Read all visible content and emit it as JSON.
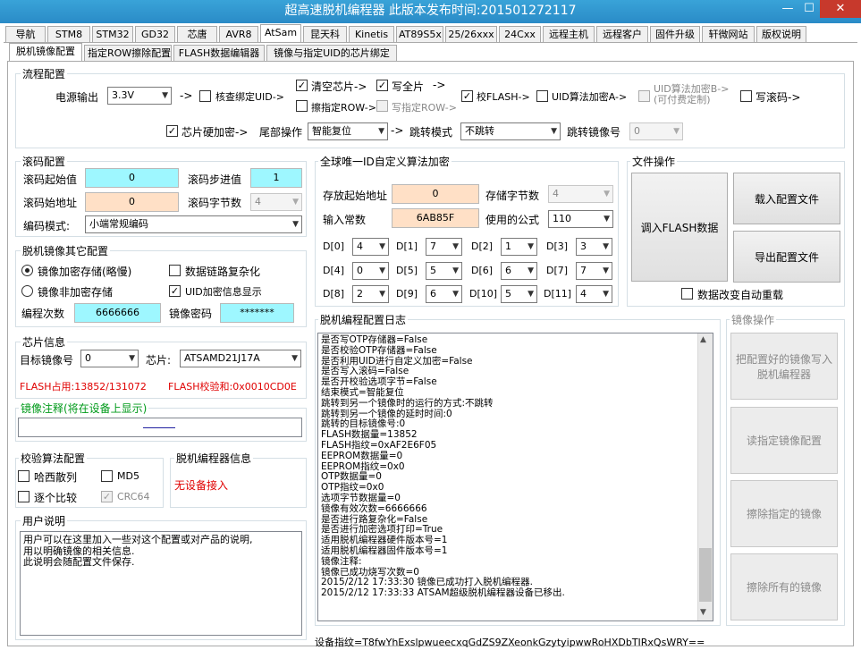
{
  "window": {
    "title": "超高速脱机编程器      此版本发布时间:201501272117",
    "min_label": "—",
    "max_label": "☐",
    "close_label": "✕"
  },
  "main_tabs": [
    "导航",
    "STM8",
    "STM32",
    "GD32",
    "芯唐",
    "AVR8",
    "AtSam",
    "昆天科",
    "Kinetis",
    "AT89S5x",
    "25/26xxx",
    "24Cxx",
    "远程主机",
    "远程客户",
    "固件升级",
    "轩微网站",
    "版权说明"
  ],
  "sub_tabs": [
    "脱机镜像配置",
    "指定ROW擦除配置",
    "FLASH数据编辑器",
    "镜像与指定UID的芯片绑定"
  ],
  "flow": {
    "title": "流程配置",
    "power_label": "电源输出",
    "power_value": "3.3V",
    "arrow": "->",
    "verify_uid": "核查绑定UID->",
    "clear_chip": "清空芯片->",
    "write_all": "写全片",
    "write_arrow": "->",
    "verify_flash": "校FLASH->",
    "uid_a": "UID算法加密A->",
    "uid_b": "UID算法加密B->\n(可付费定制)",
    "write_code": "写滚码->",
    "erase_row": "擦指定ROW->",
    "write_row": "写指定ROW->",
    "chip_hw": "芯片硬加密->",
    "tail_label": "尾部操作",
    "tail_value": "智能复位",
    "jump_mode_label": "跳转模式",
    "jump_mode_value": "不跳转",
    "jump_image_label": "跳转镜像号",
    "jump_image_value": "0"
  },
  "rolling": {
    "title": "滚码配置",
    "start_label": "滚码起始值",
    "start_value": "0",
    "step_label": "滚码步进值",
    "step_value": "1",
    "addr_label": "滚码始地址",
    "addr_value": "0",
    "bytes_label": "滚码字节数",
    "bytes_value": "4",
    "mode_label": "编码模式:",
    "mode_value": "小端常规编码"
  },
  "other": {
    "title": "脱机镜像其它配置",
    "enc_store": "镜像加密存储(略慢)",
    "nonenc_store": "镜像非加密存储",
    "link_complex": "数据链路复杂化",
    "uid_show": "UID加密信息显示",
    "count_label": "编程次数",
    "count_value": "6666666",
    "pwd_label": "镜像密码",
    "pwd_value": "*******"
  },
  "chip": {
    "title": "芯片信息",
    "target_label": "目标镜像号",
    "target_value": "0",
    "chip_label": "芯片:",
    "chip_value": "ATSAMD21J17A",
    "flash_used": "FLASH占用:13852/131072",
    "flash_checksum": "FLASH校验和:0x0010CD0E"
  },
  "note": {
    "title": "镜像注释(将在设备上显示)"
  },
  "checksum": {
    "title": "校验算法配置",
    "hash": "哈西散列",
    "md5": "MD5",
    "compare": "逐个比较",
    "crc64": "CRC64"
  },
  "programmer_info": {
    "title": "脱机编程器信息",
    "status": "无设备接入"
  },
  "user_note": {
    "title": "用户说明",
    "text": "用户可以在这里加入一些对这个配置或对产品的说明,\n用以明确镜像的相关信息.\n此说明会随配置文件保存."
  },
  "uid": {
    "title": "全球唯一ID自定义算法加密",
    "addr_label": "存放起始地址",
    "addr_value": "0",
    "bytes_label": "存储字节数",
    "bytes_value": "4",
    "const_label": "输入常数",
    "const_value": "6AB85F",
    "formula_label": "使用的公式",
    "formula_value": "110",
    "d": [
      {
        "label": "D[0]",
        "value": "4"
      },
      {
        "label": "D[1]",
        "value": "7"
      },
      {
        "label": "D[2]",
        "value": "1"
      },
      {
        "label": "D[3]",
        "value": "3"
      },
      {
        "label": "D[4]",
        "value": "0"
      },
      {
        "label": "D[5]",
        "value": "5"
      },
      {
        "label": "D[6]",
        "value": "6"
      },
      {
        "label": "D[7]",
        "value": "7"
      },
      {
        "label": "D[8]",
        "value": "2"
      },
      {
        "label": "D[9]",
        "value": "6"
      },
      {
        "label": "D[10]",
        "value": "5"
      },
      {
        "label": "D[11]",
        "value": "4"
      }
    ]
  },
  "file_ops": {
    "title": "文件操作",
    "load_flash": "调入FLASH数据",
    "load_config": "载入配置文件",
    "export_config": "导出配置文件",
    "auto_reload": "数据改变自动重载"
  },
  "log": {
    "title": "脱机编程配置日志",
    "text": "是否写OTP存储器=False\n是否校验OTP存储器=False\n是否利用UID进行自定义加密=False\n是否写入滚码=False\n是否开校验选项字节=False\n结束模式=智能复位\n跳转到另一个镜像时的运行的方式:不跳转\n跳转到另一个镜像的延时时间:0\n跳转的目标镜像号:0\nFLASH数据量=13852\nFLASH指纹=0xAF2E6F05\nEEPROM数据量=0\nEEPROM指纹=0x0\nOTP数据量=0\nOTP指纹=0x0\n选项字节数据量=0\n镜像有效次数=6666666\n是否进行路复杂化=False\n是否进行加密选项打印=True\n适用脱机编程器硬件版本号=1\n适用脱机编程器固件版本号=1\n镜像注释:\n镜像已成功烧写次数=0\n2015/2/12 17:33:30 镜像已成功打入脱机编程器.\n2015/2/12 17:33:33 ATSAM超级脱机编程器设备已移出."
  },
  "image_ops": {
    "title": "镜像操作",
    "write_image": "把配置好的镜像写入\n脱机编程器",
    "read_image": "读指定镜像配置",
    "erase_image": "擦除指定的镜像",
    "erase_all": "擦除所有的镜像"
  },
  "status_bar": "设备指纹=T8fwYhExslpwueecxqGdZS9ZXeonkGzytyipwwRoHXDbTIRxQsWRY=="
}
